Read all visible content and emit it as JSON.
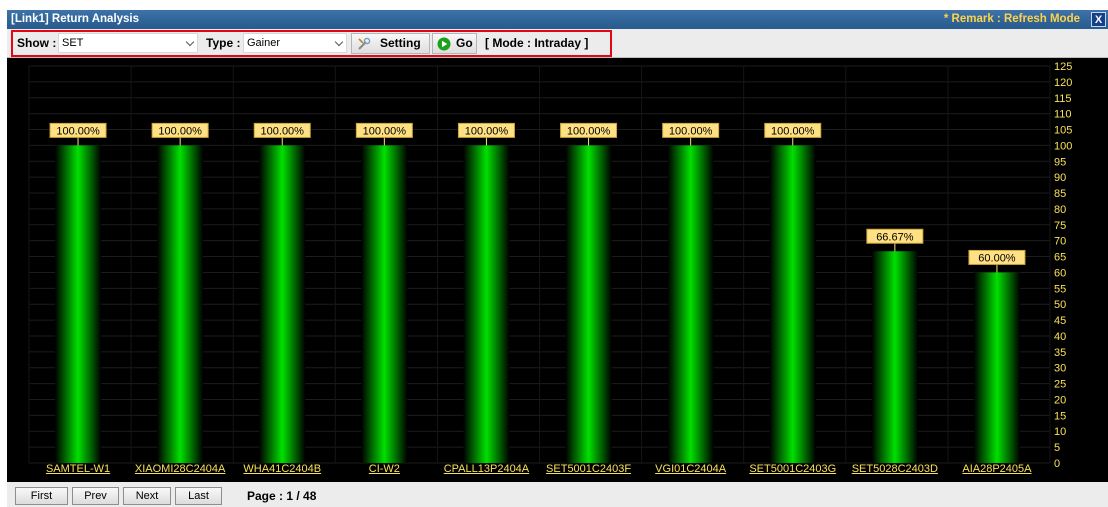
{
  "window": {
    "title": "[Link1] Return Analysis",
    "remark": "* Remark : Refresh Mode",
    "close_label": "X"
  },
  "toolbar": {
    "show_label": "Show :",
    "show_value": "SET",
    "type_label": "Type :",
    "type_value": "Gainer",
    "setting_label": "Setting",
    "go_label": "Go",
    "mode_text": "[ Mode : Intraday ]"
  },
  "colors": {
    "bar": "#00e000",
    "label_bg": "#ffe082",
    "axis_text": "#f7e15a",
    "titlebar": "#2d6296",
    "highlight_frame": "#e30613"
  },
  "chart_data": {
    "type": "bar",
    "categories": [
      "SAMTEL-W1",
      "XIAOMI28C2404A",
      "WHA41C2404B",
      "CI-W2",
      "CPALL13P2404A",
      "SET5001C2403F",
      "VGI01C2404A",
      "SET5001C2403G",
      "SET5028C2403D",
      "AIA28P2405A"
    ],
    "values": [
      100,
      100,
      100,
      100,
      100,
      100,
      100,
      100,
      66.67,
      60
    ],
    "data_labels": [
      "100.00%",
      "100.00%",
      "100.00%",
      "100.00%",
      "100.00%",
      "100.00%",
      "100.00%",
      "100.00%",
      "66.67%",
      "60.00%"
    ],
    "ylim": [
      0,
      125
    ],
    "ytick_step": 5,
    "grid": true,
    "axis_side": "right"
  },
  "pager": {
    "first": "First",
    "prev": "Prev",
    "next": "Next",
    "last": "Last",
    "page_text": "Page : 1 / 48"
  }
}
